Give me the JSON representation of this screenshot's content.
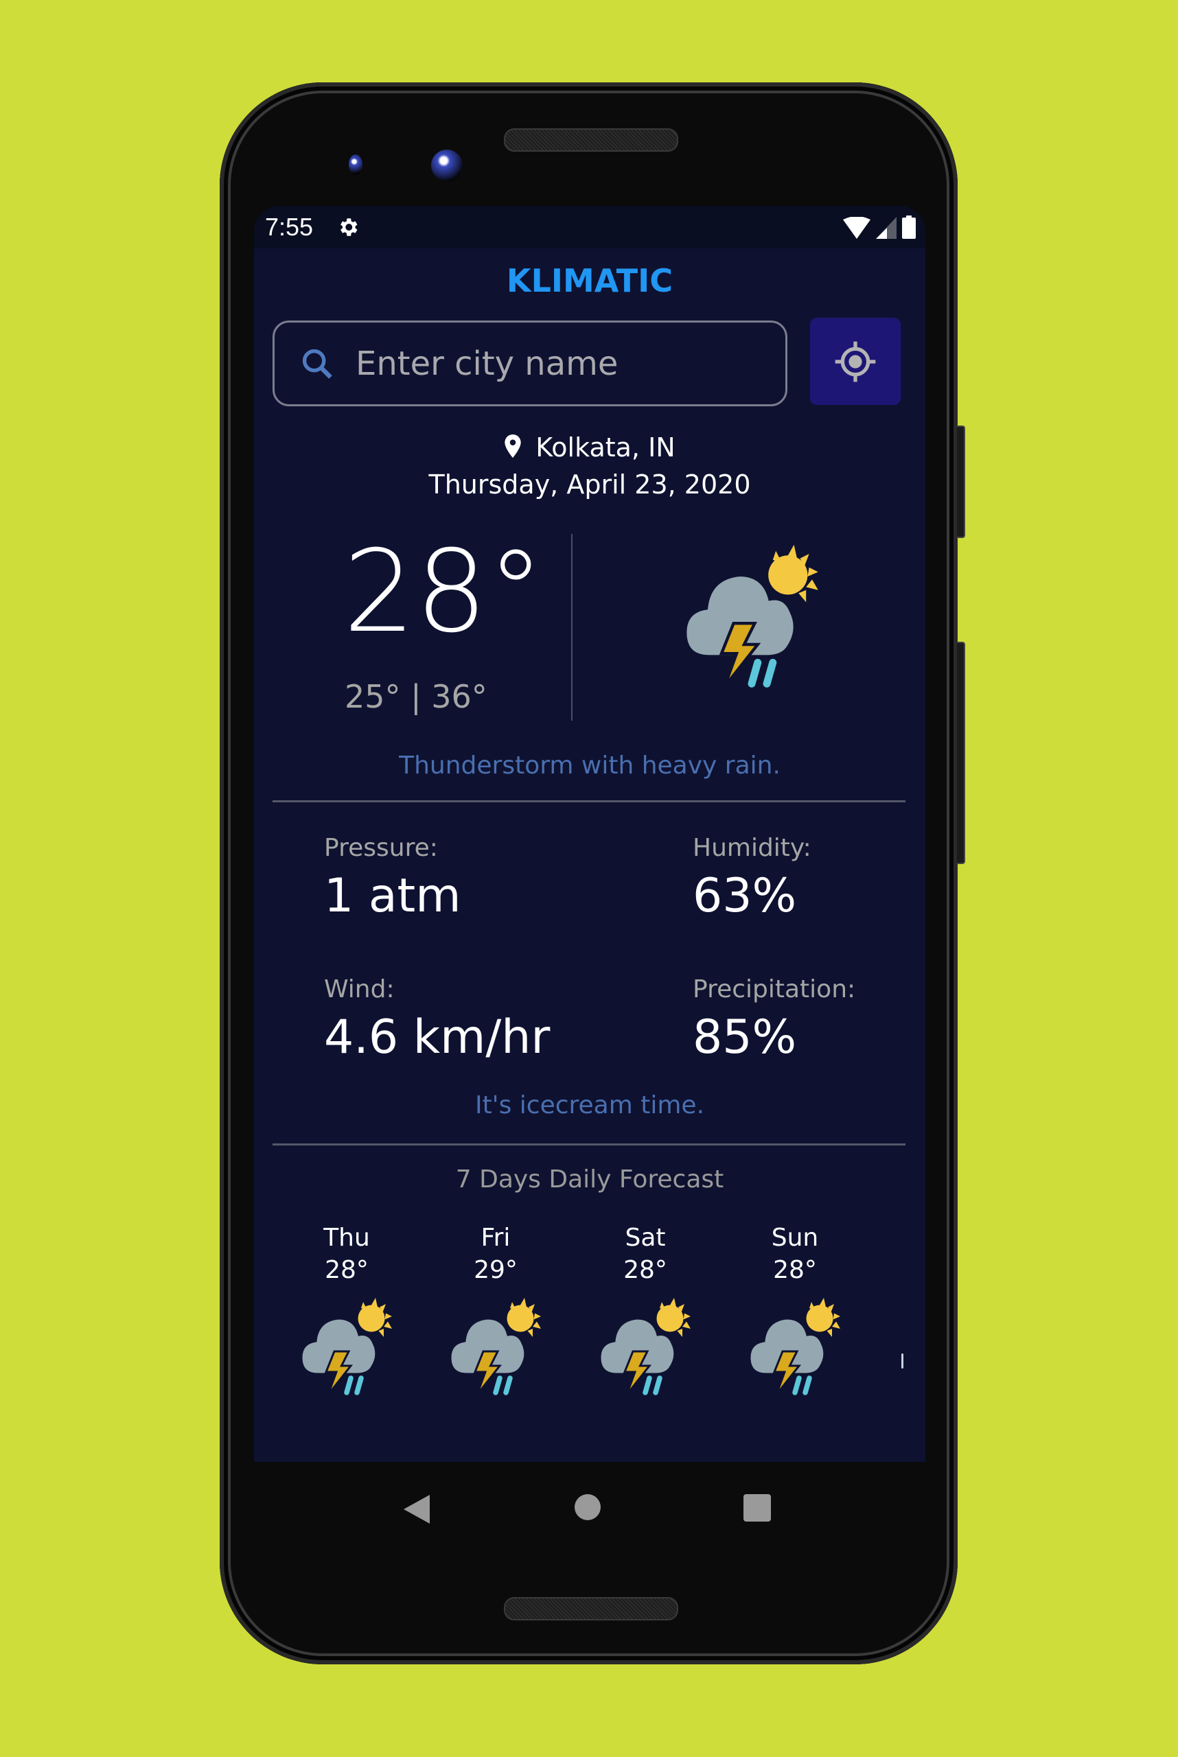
{
  "status_bar": {
    "time": "7:55",
    "icons": [
      "gear-icon",
      "wifi-icon",
      "signal-icon",
      "battery-icon"
    ]
  },
  "app": {
    "title": "KLIMATIC",
    "accent_color": "#2196F3"
  },
  "search": {
    "placeholder": "Enter city name",
    "value": "",
    "icon": "search-icon"
  },
  "locate_button": {
    "icon": "my-location-icon",
    "color": "#1E1675"
  },
  "current": {
    "location": "Kolkata, IN",
    "date": "Thursday, April 23, 2020",
    "temperature": "28°",
    "min_max": "25° | 36°",
    "icon": "thunderstorm-sun-icon",
    "description": "Thunderstorm with heavy rain."
  },
  "details": {
    "pressure": {
      "label": "Pressure:",
      "value": "1 atm"
    },
    "humidity": {
      "label": "Humidity:",
      "value": "63%"
    },
    "wind": {
      "label": "Wind:",
      "value": "4.6 km/hr"
    },
    "precipitation": {
      "label": "Precipitation:",
      "value": "85%"
    },
    "tip": "It's icecream time."
  },
  "forecast": {
    "title": "7 Days Daily Forecast",
    "days": [
      {
        "day": "Thu",
        "temp": "28°",
        "icon": "thunderstorm-sun-icon"
      },
      {
        "day": "Fri",
        "temp": "29°",
        "icon": "thunderstorm-sun-icon"
      },
      {
        "day": "Sat",
        "temp": "28°",
        "icon": "thunderstorm-sun-icon"
      },
      {
        "day": "Sun",
        "temp": "28°",
        "icon": "thunderstorm-sun-icon"
      }
    ]
  },
  "nav_bar": {
    "buttons": [
      "back-icon",
      "home-icon",
      "recents-icon"
    ]
  }
}
